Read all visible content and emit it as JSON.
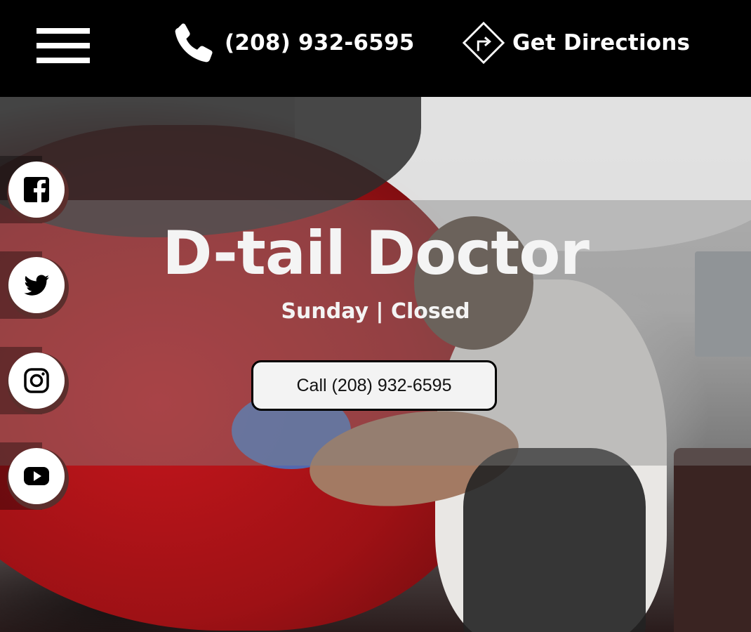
{
  "header": {
    "menu_icon": "hamburger-menu-icon",
    "phone_icon": "phone-icon",
    "phone_text": "(208) 932-6595",
    "directions_icon": "directions-sign-icon",
    "directions_text": "Get Directions"
  },
  "hero": {
    "title": "D-tail Doctor",
    "hours": "Sunday | Closed",
    "call_button_label": "Call (208) 932-6595"
  },
  "social": [
    {
      "icon": "facebook-icon"
    },
    {
      "icon": "twitter-icon"
    },
    {
      "icon": "instagram-icon"
    },
    {
      "icon": "youtube-icon"
    }
  ],
  "colors": {
    "header_bg": "#000000",
    "header_text": "#ffffff",
    "button_bg": "#f3f3f3",
    "button_border": "#000000"
  }
}
